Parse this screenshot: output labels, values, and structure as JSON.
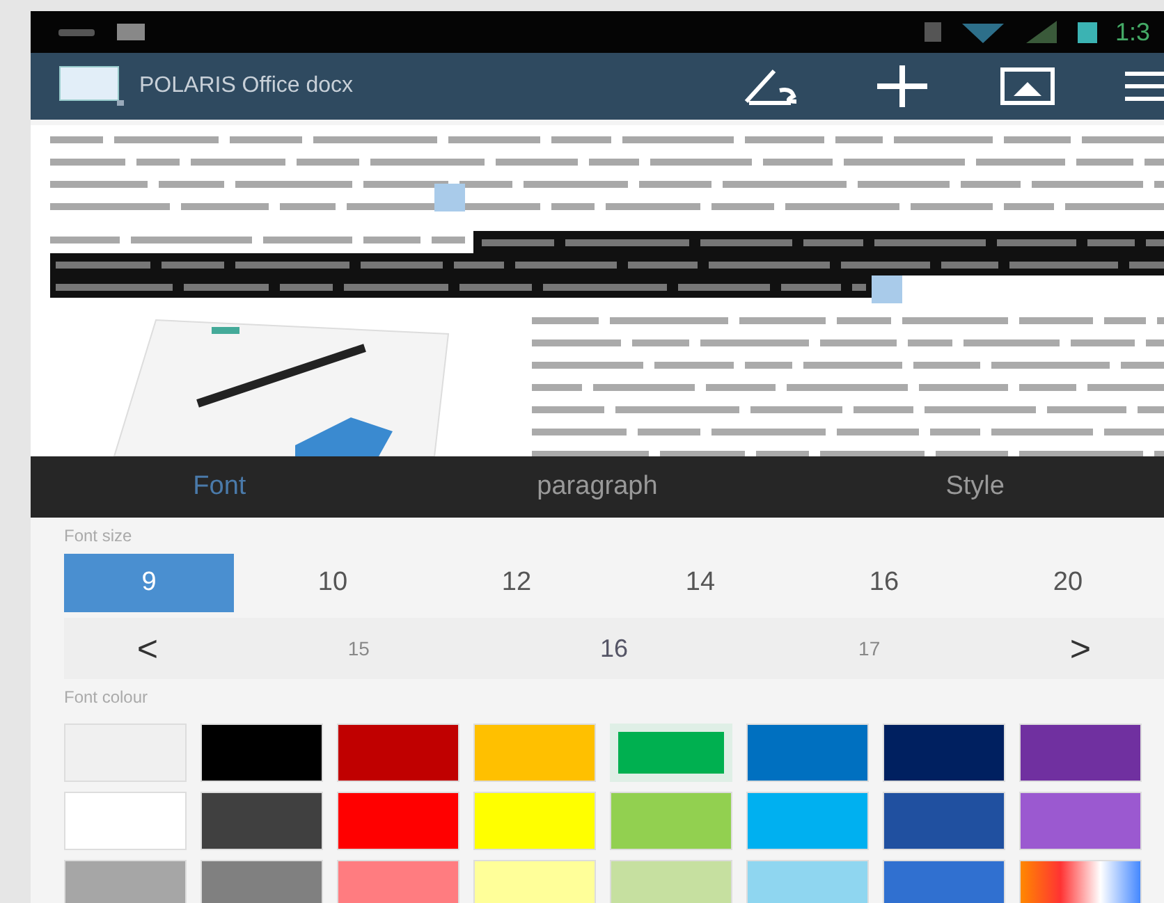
{
  "status_bar": {
    "time": "1:3"
  },
  "app_bar": {
    "title": "POLARIS Office docx"
  },
  "tabs": [
    {
      "label": "Font",
      "selected": true
    },
    {
      "label": "paragraph",
      "selected": false
    },
    {
      "label": "Style",
      "selected": false
    }
  ],
  "font_size": {
    "label": "Font size",
    "sizes": [
      {
        "label": "9",
        "selected": true
      },
      {
        "label": "10",
        "selected": false
      },
      {
        "label": "12",
        "selected": false
      },
      {
        "label": "14",
        "selected": false
      },
      {
        "label": "16",
        "selected": false
      },
      {
        "label": "20",
        "selected": false
      }
    ],
    "stepper": {
      "prev": "<",
      "next": ">",
      "values": [
        {
          "label": "15",
          "selected": false
        },
        {
          "label": "16",
          "selected": true
        },
        {
          "label": "17",
          "selected": false
        }
      ]
    }
  },
  "font_colour": {
    "label": "Font colour",
    "swatches": [
      {
        "kind": "swatch",
        "color": "#f0f0f0",
        "selected": false
      },
      {
        "kind": "swatch",
        "color": "#000000",
        "selected": false
      },
      {
        "kind": "swatch",
        "color": "#c00000",
        "selected": false
      },
      {
        "kind": "swatch",
        "color": "#ffc000",
        "selected": false
      },
      {
        "kind": "swatch",
        "color": "#00b050",
        "selected": true
      },
      {
        "kind": "swatch",
        "color": "#0070c0",
        "selected": false
      },
      {
        "kind": "swatch",
        "color": "#002060",
        "selected": false
      },
      {
        "kind": "swatch",
        "color": "#7030a0",
        "selected": false
      },
      {
        "kind": "swatch",
        "color": "#ffffff",
        "selected": false
      },
      {
        "kind": "swatch",
        "color": "#404040",
        "selected": false
      },
      {
        "kind": "swatch",
        "color": "#ff0000",
        "selected": false
      },
      {
        "kind": "swatch",
        "color": "#ffff00",
        "selected": false
      },
      {
        "kind": "swatch",
        "color": "#92d050",
        "selected": false
      },
      {
        "kind": "swatch",
        "color": "#00b0f0",
        "selected": false
      },
      {
        "kind": "swatch",
        "color": "#2050a0",
        "selected": false
      },
      {
        "kind": "swatch",
        "color": "#9b59d0",
        "selected": false
      },
      {
        "kind": "swatch",
        "color": "#a6a6a6",
        "selected": false
      },
      {
        "kind": "swatch",
        "color": "#808080",
        "selected": false
      },
      {
        "kind": "swatch",
        "color": "#ff7c80",
        "selected": false
      },
      {
        "kind": "swatch",
        "color": "#ffff99",
        "selected": false
      },
      {
        "kind": "swatch",
        "color": "#c6e0a0",
        "selected": false
      },
      {
        "kind": "swatch",
        "color": "#8fd6f0",
        "selected": false
      },
      {
        "kind": "swatch",
        "color": "#3070d0",
        "selected": false
      },
      {
        "kind": "picker",
        "selected": false
      }
    ]
  }
}
